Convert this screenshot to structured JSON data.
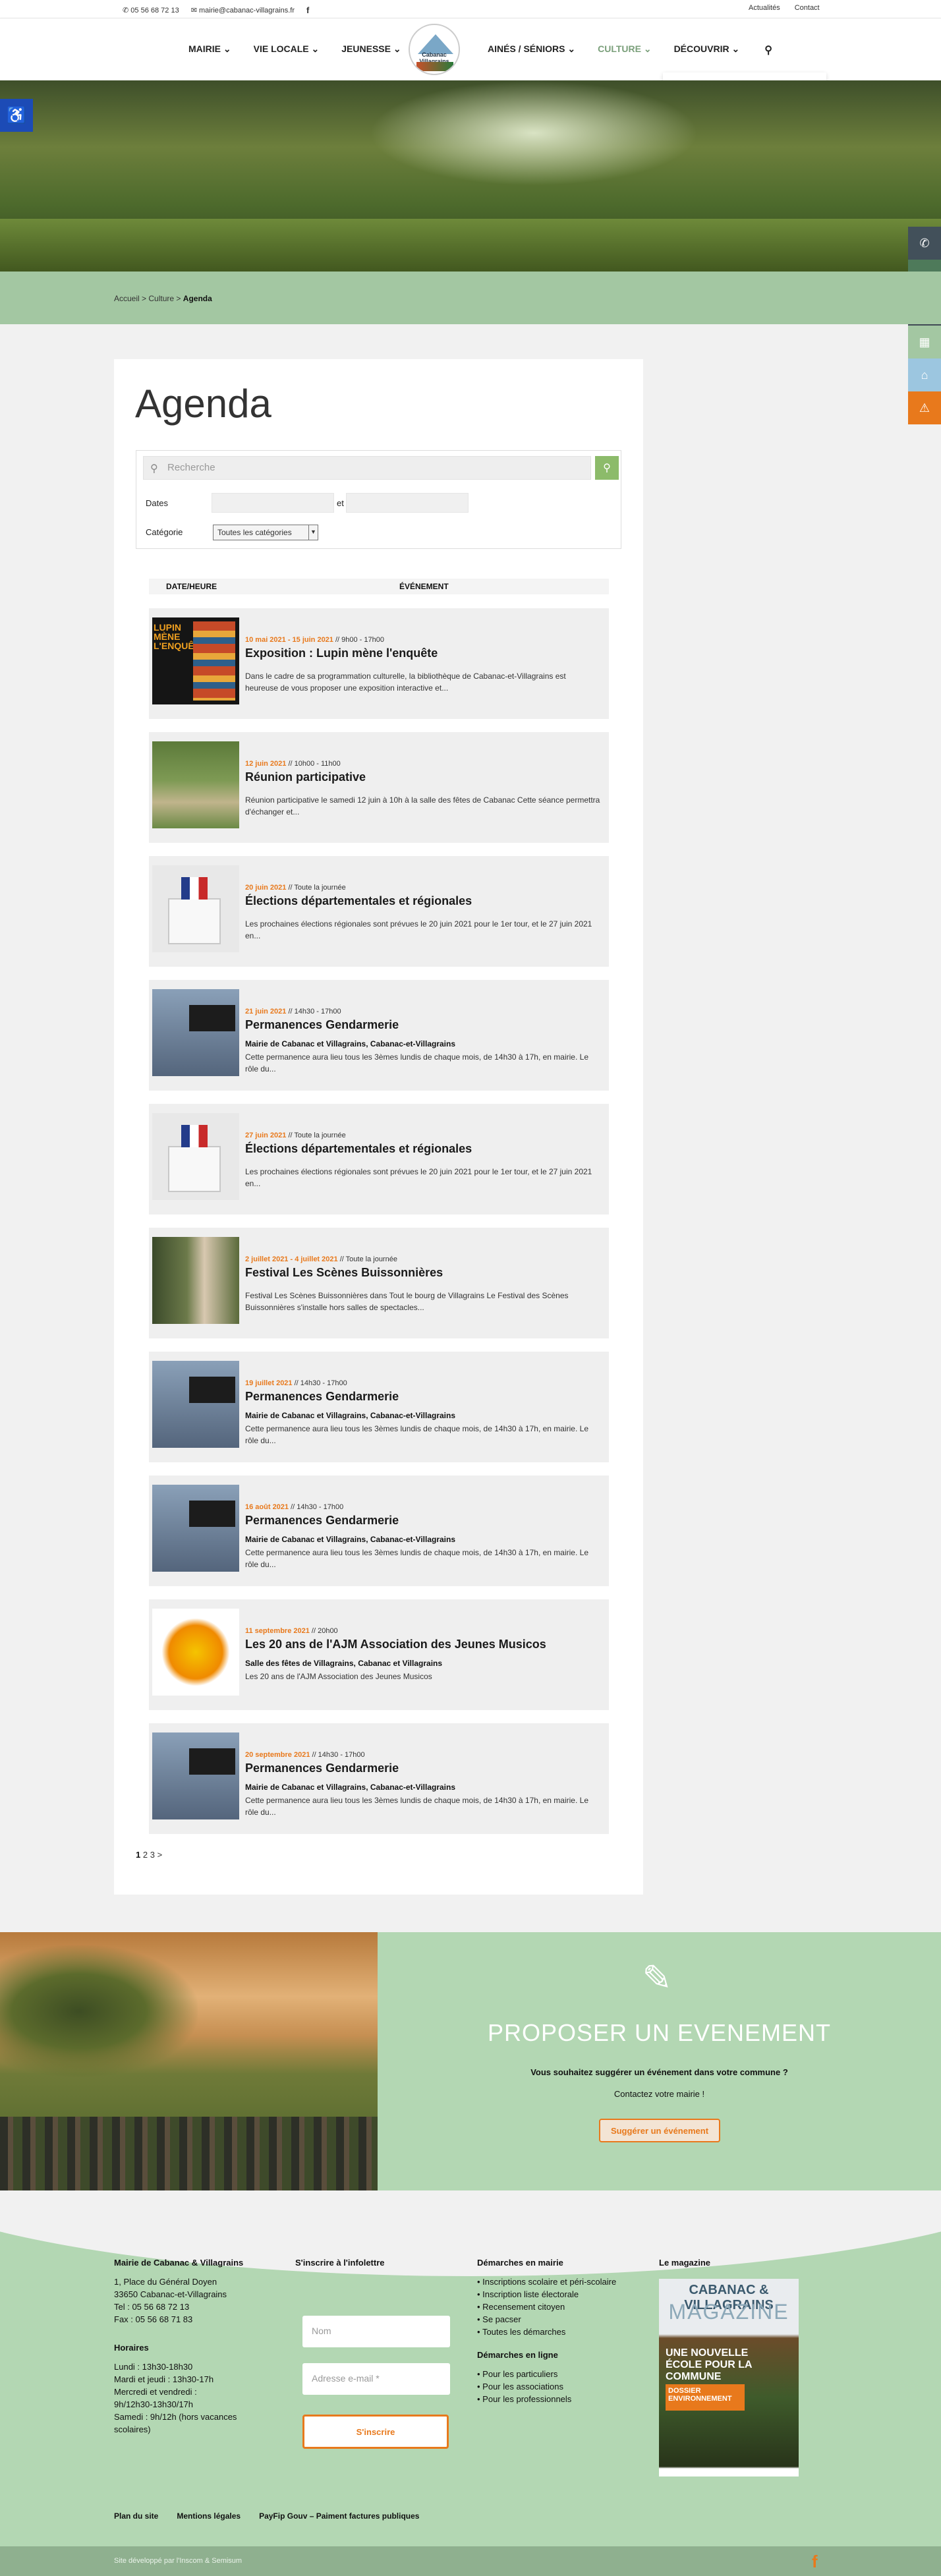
{
  "topbar": {
    "phone": "05 56 68 72 13",
    "email": "mairie@cabanac-villagrains.fr",
    "facebook_icon": "facebook-icon",
    "links": [
      "Actualités",
      "Contact"
    ]
  },
  "nav": {
    "left": [
      "MAIRIE",
      "VIE LOCALE",
      "JEUNESSE"
    ],
    "right": [
      "AINÉS / SÉNIORS",
      "CULTURE",
      "DÉCOUVRIR"
    ],
    "logo_text": "Cabanac Villagrains",
    "active_color": "#7a9f7a",
    "accent_color": "#e8791c"
  },
  "side_icons": [
    "phone-icon",
    "tag-icon",
    "laptop-icon",
    "grid-icon",
    "cart-icon",
    "warning-icon"
  ],
  "breadcrumb": {
    "home": "Accueil",
    "sep": ">",
    "section": "Culture",
    "current": "Agenda"
  },
  "page_title": "Agenda",
  "filter": {
    "search_placeholder": "Recherche",
    "dates_label": "Dates",
    "et": "et",
    "category_label": "Catégorie",
    "category_value": "Toutes les catégories"
  },
  "table": {
    "col_date": "DATE/HEURE",
    "col_event": "ÉVÉNEMENT"
  },
  "events": [
    {
      "date": "10 mai 2021 - 15 juin 2021",
      "time": "// 9h00 - 17h00",
      "name": "Exposition : Lupin mène l'enquête",
      "location": "",
      "desc": "Dans le cadre de sa programmation culturelle, la bibliothèque de Cabanac-et-Villagrains est heureuse de vous proposer une exposition interactive et..."
    },
    {
      "date": "12 juin 2021",
      "time": "// 10h00 - 11h00",
      "name": "Réunion participative",
      "location": "",
      "desc": "Réunion participative le samedi 12 juin à 10h à la salle des fêtes de Cabanac Cette séance permettra d'échanger et..."
    },
    {
      "date": "20 juin 2021",
      "time": "// Toute la journée",
      "name": "Élections départementales et régionales",
      "location": "",
      "desc": "Les prochaines élections régionales sont prévues le 20 juin 2021 pour le 1er tour, et le 27 juin 2021 en..."
    },
    {
      "date": "21 juin 2021",
      "time": "// 14h30 - 17h00",
      "name": "Permanences Gendarmerie",
      "location": "Mairie de Cabanac et Villagrains, Cabanac-et-Villagrains",
      "desc": "Cette permanence aura lieu tous les 3èmes lundis de chaque mois, de 14h30 à 17h, en mairie. Le rôle du..."
    },
    {
      "date": "27 juin 2021",
      "time": "// Toute la journée",
      "name": "Élections départementales et régionales",
      "location": "",
      "desc": "Les prochaines élections régionales sont prévues le 20 juin 2021 pour le 1er tour, et le 27 juin 2021 en..."
    },
    {
      "date": "2 juillet 2021 - 4 juillet 2021",
      "time": "// Toute la journée",
      "name": "Festival Les Scènes Buissonnières",
      "location": "",
      "desc": "Festival Les Scènes Buissonnières dans Tout le bourg de Villagrains Le Festival des Scènes Buissonnières s'installe hors salles de spectacles..."
    },
    {
      "date": "19 juillet 2021",
      "time": "// 14h30 - 17h00",
      "name": "Permanences Gendarmerie",
      "location": "Mairie de Cabanac et Villagrains, Cabanac-et-Villagrains",
      "desc": "Cette permanence aura lieu tous les 3èmes lundis de chaque mois, de 14h30 à 17h, en mairie. Le rôle du..."
    },
    {
      "date": "16 août 2021",
      "time": "// 14h30 - 17h00",
      "name": "Permanences Gendarmerie",
      "location": "Mairie de Cabanac et Villagrains, Cabanac-et-Villagrains",
      "desc": "Cette permanence aura lieu tous les 3èmes lundis de chaque mois, de 14h30 à 17h, en mairie. Le rôle du..."
    },
    {
      "date": "11 septembre 2021",
      "time": "// 20h00",
      "name": "Les 20 ans de l'AJM Association des Jeunes Musicos",
      "location": "Salle des fêtes de Villagrains, Cabanac et Villagrains",
      "desc": "Les 20 ans de l'AJM Association des Jeunes Musicos"
    },
    {
      "date": "20 septembre 2021",
      "time": "// 14h30 - 17h00",
      "name": "Permanences Gendarmerie",
      "location": "Mairie de Cabanac et Villagrains, Cabanac-et-Villagrains",
      "desc": "Cette permanence aura lieu tous les 3èmes lundis de chaque mois, de 14h30 à 17h, en mairie. Le rôle du..."
    }
  ],
  "pagination": {
    "current": "1",
    "p2": "2",
    "p3": "3",
    "next": ">"
  },
  "promo": {
    "title": "PROPOSER UN EVENEMENT",
    "question": "Vous souhaitez suggérer un événement dans votre commune ?",
    "contact": "Contactez votre mairie !",
    "button": "Suggérer un événement"
  },
  "footer": {
    "mairie": {
      "title": "Mairie de Cabanac & Villagrains",
      "addr1": "1, Place du Général Doyen",
      "addr2": "33650 Cabanac-et-Villagrains",
      "tel": "Tel : 05 56 68 72 13",
      "fax": "Fax : 05 56 68 71 83",
      "hours_title": "Horaires",
      "h1": "Lundi : 13h30-18h30",
      "h2": "Mardi et jeudi : 13h30-17h",
      "h3": "Mercredi et vendredi :",
      "h4": "9h/12h30-13h30/17h",
      "h5": "Samedi : 9h/12h (hors vacances",
      "h6": "scolaires)"
    },
    "newsletter": {
      "title": "S'inscrire à l'infolettre",
      "name_ph": "Nom",
      "email_ph": "Adresse e-mail *",
      "button": "S'inscrire"
    },
    "demarches": {
      "title": "Démarches en mairie",
      "items": [
        "Inscriptions scolaire et péri-scolaire",
        "Inscription liste électorale",
        "Recensement citoyen",
        "Se pacser",
        "Toutes les démarches"
      ],
      "online_title": "Démarches en ligne",
      "online_items": [
        "Pour les particuliers",
        "Pour les associations",
        "Pour les professionnels"
      ]
    },
    "magazine": {
      "title": "Le magazine",
      "cover1": "CABANAC & VILLAGRAINS",
      "cover2": "MAGAZINE",
      "cover3": "UNE NOUVELLE ÉCOLE POUR LA COMMUNE",
      "cover4": "DOSSIER ENVIRONNEMENT"
    },
    "links": [
      "Plan du site",
      "Mentions légales",
      "PayFip Gouv – Paiment factures publiques"
    ],
    "credit": "Site développé par l'Inscom & Semisum"
  }
}
